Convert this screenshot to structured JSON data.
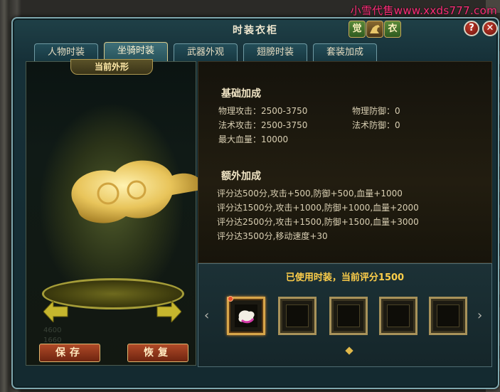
{
  "watermark": "小雪代售www.xxds777.com",
  "window": {
    "title": "时装衣柜",
    "title_icons": [
      "觉",
      "",
      "衣"
    ],
    "help_label": "?",
    "close_label": "✕"
  },
  "tabs": [
    {
      "label": "人物时装",
      "active": false
    },
    {
      "label": "坐骑时装",
      "active": true
    },
    {
      "label": "武器外观",
      "active": false
    },
    {
      "label": "翅膀时装",
      "active": false
    },
    {
      "label": "套装加成",
      "active": false
    }
  ],
  "preview": {
    "label": "当前外形",
    "save_label": "保存",
    "restore_label": "恢复",
    "faint_lines": [
      "4600",
      "1660",
      "82170"
    ]
  },
  "base_bonus": {
    "title": "基础加成",
    "stats": [
      {
        "label": "物理攻击：2500-3750"
      },
      {
        "label": "物理防御：0"
      },
      {
        "label": "法术攻击：2500-3750"
      },
      {
        "label": "法术防御：0"
      },
      {
        "label": "最大血量：10000"
      }
    ]
  },
  "extra_bonus": {
    "title": "额外加成",
    "lines": [
      "评分达500分,攻击+500,防御+500,血量+1000",
      "评分达1500分,攻击+1000,防御+1000,血量+2000",
      "评分达2500分,攻击+1500,防御+1500,血量+3000",
      "评分达3500分,移动速度+30"
    ]
  },
  "used": {
    "title": "已使用时装，当前评分1500",
    "slot_count": 5,
    "prev_label": "‹",
    "next_label": "›"
  },
  "colors": {
    "accent_gold": "#ffcf4a",
    "window_border": "#7fa7ae",
    "button_red": "#b04a28"
  }
}
